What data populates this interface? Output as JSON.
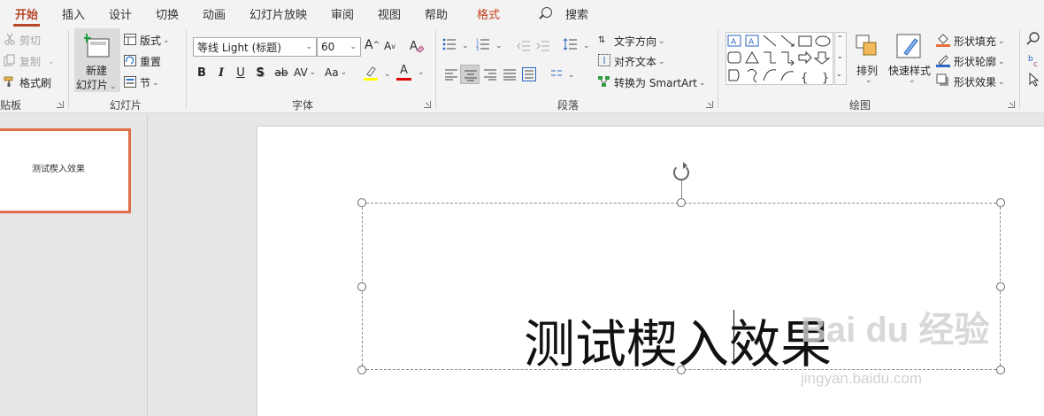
{
  "tabs": [
    {
      "label": "开始",
      "active": true
    },
    {
      "label": "插入"
    },
    {
      "label": "设计"
    },
    {
      "label": "切换"
    },
    {
      "label": "动画"
    },
    {
      "label": "幻灯片放映"
    },
    {
      "label": "审阅"
    },
    {
      "label": "视图"
    },
    {
      "label": "帮助"
    },
    {
      "label": "格式",
      "contextual": true
    }
  ],
  "search_label": "搜索",
  "clipboard": {
    "cut": "剪切",
    "copy": "复制",
    "format_painter": "格式刷",
    "group_label": "贴板"
  },
  "slides_group": {
    "new_slide_line1": "新建",
    "new_slide_line2": "幻灯片",
    "layout": "版式",
    "reset": "重置",
    "section": "节",
    "group_label": "幻灯片"
  },
  "font": {
    "name": "等线 Light (标题)",
    "size": "60",
    "grow": "A",
    "shrink": "A",
    "bold": "B",
    "italic": "I",
    "underline": "U",
    "shadow": "S",
    "strike": "ab",
    "spacing": "AV",
    "case": "Aa",
    "font_color_letter": "A",
    "group_label": "字体"
  },
  "paragraph": {
    "text_direction": "文字方向",
    "align_text": "对齐文本",
    "convert_smartart": "转换为 SmartArt",
    "group_label": "段落"
  },
  "drawing": {
    "arrange": "排列",
    "quick_styles": "快速样式",
    "shape_fill": "形状填充",
    "shape_outline": "形状轮廓",
    "shape_effects": "形状效果",
    "group_label": "绘图"
  },
  "thumbnail": {
    "text": "测试楔入效果"
  },
  "slide": {
    "title_text": "测试楔入效果"
  },
  "watermark": {
    "main": "Bai du 经验",
    "sub": "jingyan.baidu.com"
  },
  "colors": {
    "accent": "#b7472a",
    "highlight": "#ffff00",
    "font_red": "#e00000",
    "thumb_border": "#e0704c"
  }
}
